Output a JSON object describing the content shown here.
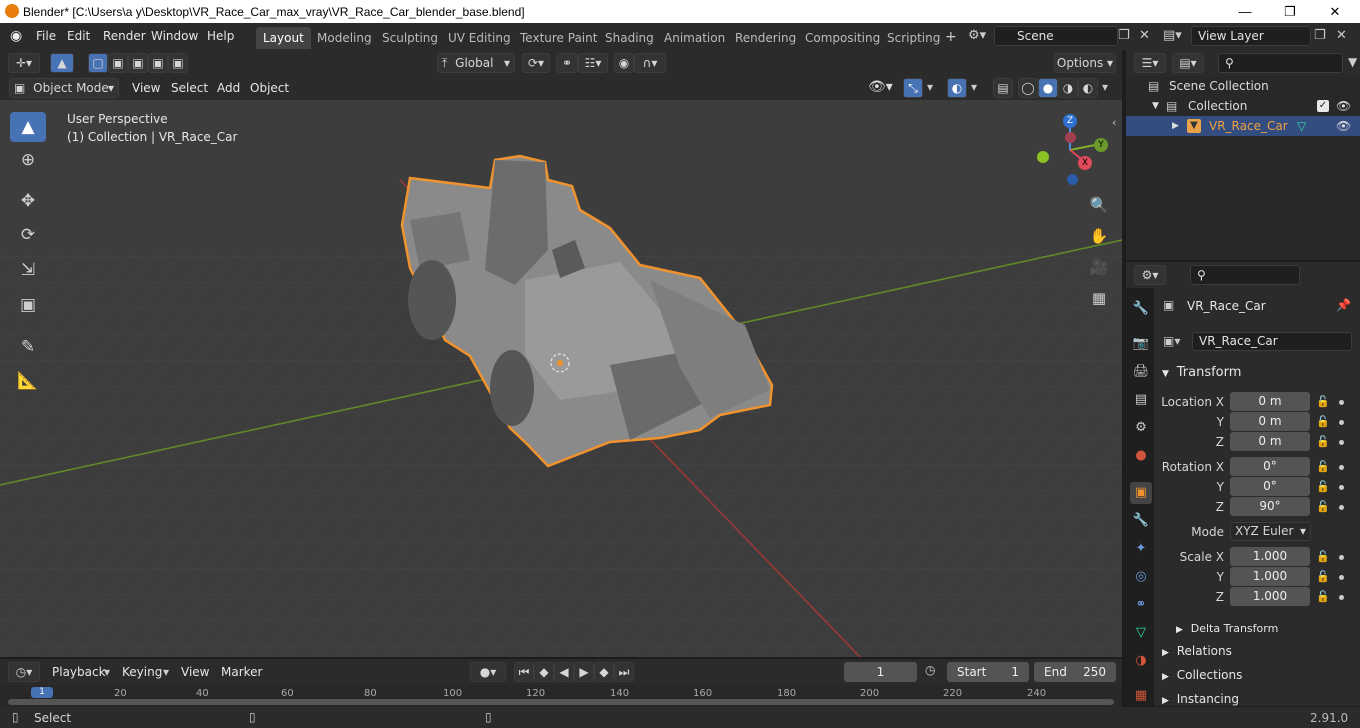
{
  "window": {
    "title": "Blender* [C:\\Users\\a y\\Desktop\\VR_Race_Car_max_vray\\VR_Race_Car_blender_base.blend]"
  },
  "menu": {
    "items": [
      "File",
      "Edit",
      "Render",
      "Window",
      "Help"
    ]
  },
  "workspaces": [
    "Layout",
    "Modeling",
    "Sculpting",
    "UV Editing",
    "Texture Paint",
    "Shading",
    "Animation",
    "Rendering",
    "Compositing",
    "Scripting"
  ],
  "scene": {
    "name": "Scene"
  },
  "view_layer": {
    "name": "View Layer"
  },
  "header": {
    "transform_orientation": "Global",
    "options_label": "Options",
    "mode": "Object Mode",
    "menus": [
      "View",
      "Select",
      "Add",
      "Object"
    ]
  },
  "viewport": {
    "perspective": "User Perspective",
    "collection_info": "(1) Collection | VR_Race_Car",
    "gizmo": {
      "x": "X",
      "y": "Y",
      "z": "Z"
    }
  },
  "outliner": {
    "rows": [
      "Scene Collection",
      "Collection",
      "VR_Race_Car"
    ]
  },
  "properties": {
    "object_name": "VR_Race_Car",
    "data_name": "VR_Race_Car",
    "transform_label": "Transform",
    "location": {
      "label": "Location X",
      "x": "0 m",
      "y": "0 m",
      "z": "0 m"
    },
    "rotation": {
      "label": "Rotation X",
      "x": "0°",
      "y": "0°",
      "z": "90°"
    },
    "mode": {
      "label": "Mode",
      "value": "XYZ Euler"
    },
    "scale": {
      "label": "Scale X",
      "x": "1.000",
      "y": "1.000",
      "z": "1.000"
    },
    "axis_y": "Y",
    "axis_z": "Z",
    "sections": [
      "Delta Transform",
      "Relations",
      "Collections",
      "Instancing"
    ]
  },
  "timeline": {
    "menus": [
      "Playback",
      "Keying",
      "View",
      "Marker"
    ],
    "current_frame": "1",
    "start_label": "Start",
    "start": "1",
    "end_label": "End",
    "end": "250",
    "ticks": [
      "1",
      "20",
      "40",
      "60",
      "80",
      "100",
      "120",
      "140",
      "160",
      "180",
      "200",
      "220",
      "240"
    ]
  },
  "status": {
    "left": "Select",
    "version": "2.91.0"
  },
  "colors": {
    "accent": "#4772b3",
    "selection_outline": "#f0932e",
    "x_axis": "#b33c3c",
    "y_axis": "#6a9a2a"
  }
}
